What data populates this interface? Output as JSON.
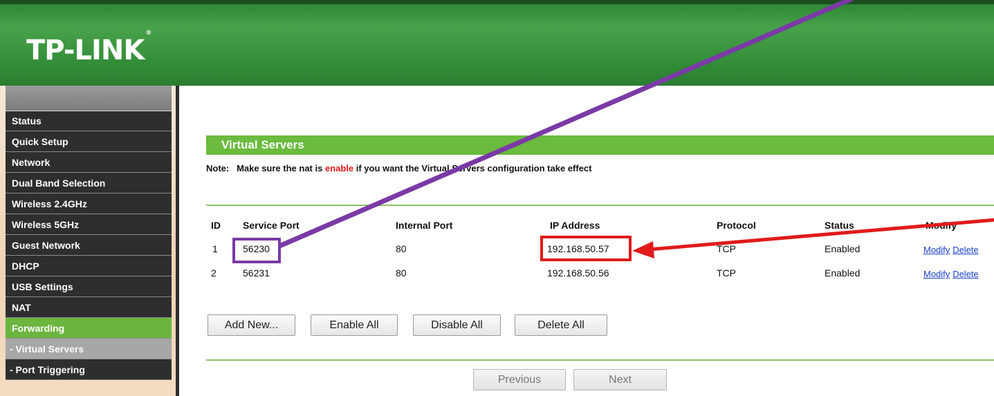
{
  "brand": {
    "name": "TP-LINK",
    "mark": "®"
  },
  "sidebar": {
    "items": [
      {
        "label": "Status"
      },
      {
        "label": "Quick Setup"
      },
      {
        "label": "Network"
      },
      {
        "label": "Dual Band Selection"
      },
      {
        "label": "Wireless 2.4GHz"
      },
      {
        "label": "Wireless 5GHz"
      },
      {
        "label": "Guest Network"
      },
      {
        "label": "DHCP"
      },
      {
        "label": "USB Settings"
      },
      {
        "label": "NAT"
      },
      {
        "label": "Forwarding"
      },
      {
        "label": "- Virtual Servers"
      },
      {
        "label": "- Port Triggering"
      }
    ]
  },
  "section": {
    "title": "Virtual Servers",
    "note_prefix": "Note:",
    "note_before": "Make sure the nat is ",
    "note_highlight": "enable",
    "note_after": " if you want the Virtual Servers configuration take effect"
  },
  "table": {
    "headers": [
      "ID",
      "Service Port",
      "Internal Port",
      "IP Address",
      "Protocol",
      "Status",
      "Modify"
    ],
    "rows": [
      {
        "id": "1",
        "service_port": "56230",
        "internal_port": "80",
        "ip": "192.168.50.57",
        "protocol": "TCP",
        "status": "Enabled",
        "modify": "Modify",
        "delete": "Delete"
      },
      {
        "id": "2",
        "service_port": "56231",
        "internal_port": "80",
        "ip": "192.168.50.56",
        "protocol": "TCP",
        "status": "Enabled",
        "modify": "Modify",
        "delete": "Delete"
      }
    ]
  },
  "buttons": {
    "add_new": "Add New...",
    "enable_all": "Enable All",
    "disable_all": "Disable All",
    "delete_all": "Delete All",
    "previous": "Previous",
    "next": "Next"
  },
  "annotations": {
    "purple_color": "#7a3aa6",
    "red_color": "#e01b1b"
  }
}
